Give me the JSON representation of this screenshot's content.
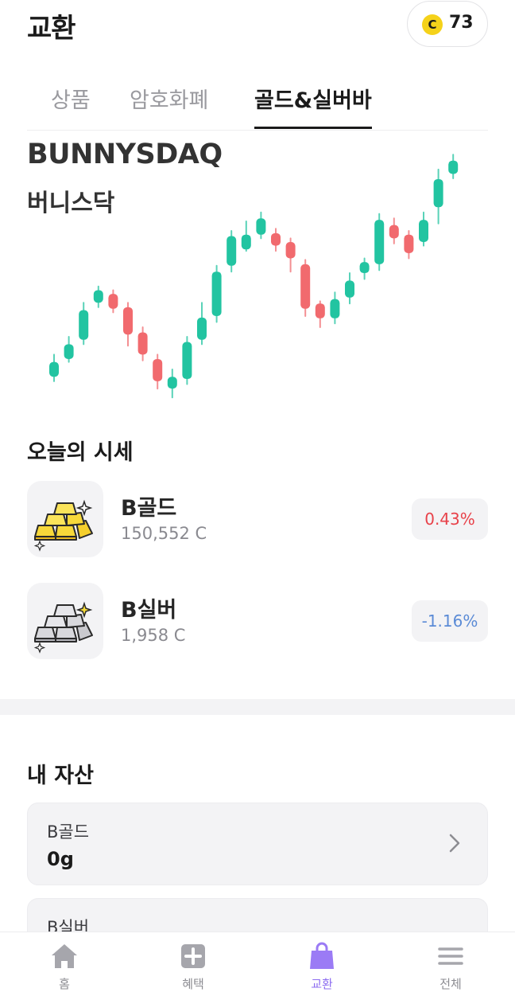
{
  "header": {
    "title": "교환",
    "coin_symbol": "C",
    "coin_balance": "73"
  },
  "tabs": [
    {
      "label": "상품",
      "active": false
    },
    {
      "label": "암호화폐",
      "active": false
    },
    {
      "label": "골드&실버바",
      "active": true
    }
  ],
  "index": {
    "ticker": "BUNNYSDAQ",
    "name_ko": "버니스닥"
  },
  "chart_data": {
    "type": "candlestick",
    "colors": {
      "up": "#22c4a1",
      "down": "#f16a6e"
    },
    "candles": [
      {
        "open": 18,
        "close": 38,
        "high": 48,
        "low": 12
      },
      {
        "open": 42,
        "close": 62,
        "high": 72,
        "low": 38
      },
      {
        "open": 68,
        "close": 108,
        "high": 118,
        "low": 62
      },
      {
        "open": 118,
        "close": 135,
        "high": 140,
        "low": 112
      },
      {
        "open": 130,
        "close": 110,
        "high": 135,
        "low": 105
      },
      {
        "open": 112,
        "close": 75,
        "high": 118,
        "low": 60
      },
      {
        "open": 78,
        "close": 48,
        "high": 85,
        "low": 40
      },
      {
        "open": 42,
        "close": 12,
        "high": 48,
        "low": 2
      },
      {
        "open": 2,
        "close": 18,
        "high": 28,
        "low": -10
      },
      {
        "open": 15,
        "close": 65,
        "high": 72,
        "low": 8
      },
      {
        "open": 68,
        "close": 98,
        "high": 118,
        "low": 62
      },
      {
        "open": 100,
        "close": 160,
        "high": 168,
        "low": 92
      },
      {
        "open": 168,
        "close": 208,
        "high": 215,
        "low": 160
      },
      {
        "open": 190,
        "close": 210,
        "high": 228,
        "low": 188
      },
      {
        "open": 210,
        "close": 232,
        "high": 240,
        "low": 205
      },
      {
        "open": 212,
        "close": 195,
        "high": 218,
        "low": 188
      },
      {
        "open": 200,
        "close": 178,
        "high": 205,
        "low": 160
      },
      {
        "open": 170,
        "close": 110,
        "high": 176,
        "low": 100
      },
      {
        "open": 117,
        "close": 97,
        "high": 120,
        "low": 85
      },
      {
        "open": 97,
        "close": 123,
        "high": 132,
        "low": 90
      },
      {
        "open": 125,
        "close": 148,
        "high": 158,
        "low": 117
      },
      {
        "open": 158,
        "close": 173,
        "high": 178,
        "low": 150
      },
      {
        "open": 170,
        "close": 230,
        "high": 238,
        "low": 162
      },
      {
        "open": 223,
        "close": 205,
        "high": 232,
        "low": 198
      },
      {
        "open": 210,
        "close": 185,
        "high": 215,
        "low": 178
      },
      {
        "open": 200,
        "close": 230,
        "high": 240,
        "low": 195
      },
      {
        "open": 247,
        "close": 285,
        "high": 298,
        "low": 225
      },
      {
        "open": 292,
        "close": 310,
        "high": 318,
        "low": 286
      }
    ]
  },
  "today": {
    "title": "오늘의 시세",
    "items": [
      {
        "name": "B골드",
        "price": "150,552 C",
        "change": "0.43%",
        "direction": "up",
        "icon": "gold-bars-icon"
      },
      {
        "name": "B실버",
        "price": "1,958 C",
        "change": "-1.16%",
        "direction": "down",
        "icon": "silver-bars-icon"
      }
    ]
  },
  "assets": {
    "title": "내 자산",
    "items": [
      {
        "label": "B골드",
        "value": "0g"
      },
      {
        "label": "B실버",
        "value": ""
      }
    ]
  },
  "nav": [
    {
      "label": "홈",
      "icon": "home-icon",
      "active": false
    },
    {
      "label": "혜택",
      "icon": "plus-box-icon",
      "active": false
    },
    {
      "label": "교환",
      "icon": "shopping-bag-icon",
      "active": true
    },
    {
      "label": "전체",
      "icon": "menu-icon",
      "active": false
    }
  ]
}
